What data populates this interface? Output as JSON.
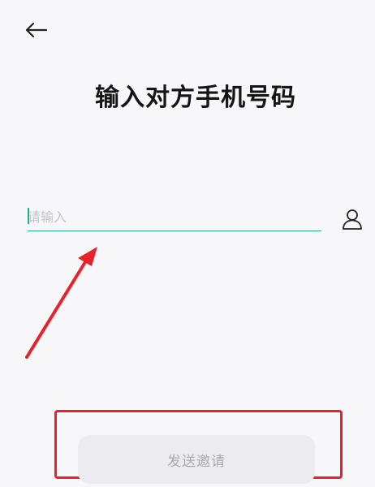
{
  "header": {
    "back_icon": "arrow-left-icon",
    "title": "输入对方手机号码"
  },
  "form": {
    "phone": {
      "value": "",
      "placeholder": "请输入"
    },
    "contact_icon": "person-icon"
  },
  "actions": {
    "send_invite_label": "发送邀请"
  },
  "colors": {
    "accent": "#19b08a",
    "annotation": "#e8212a",
    "button_bg": "#ececf0",
    "button_text": "#a9a9b1"
  }
}
